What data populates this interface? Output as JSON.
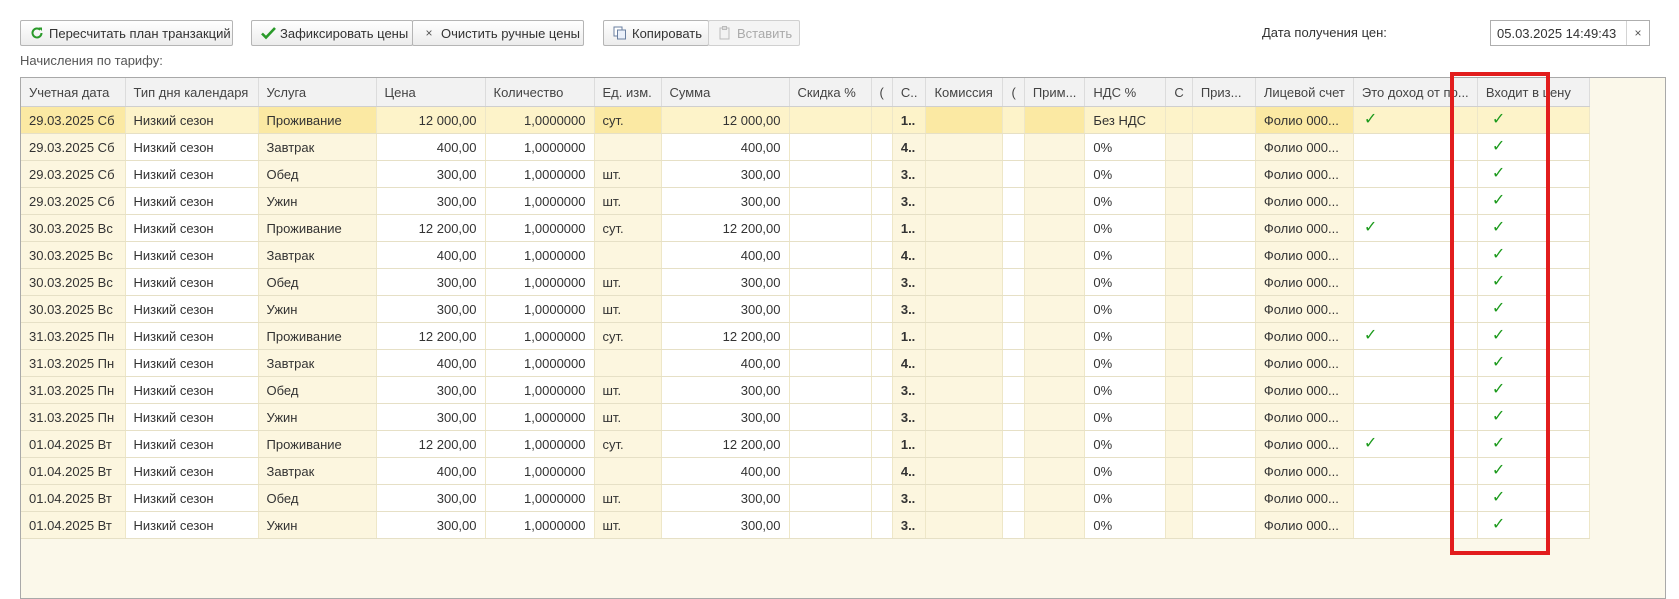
{
  "toolbar": {
    "recalc_label": "Пересчитать план транзакций",
    "fix_prices_label": "Зафиксировать цены",
    "clear_manual_label": "Очистить ручные цены",
    "copy_label": "Копировать",
    "paste_label": "Вставить"
  },
  "price_date": {
    "label": "Дата получения цен:",
    "value": "05.03.2025 14:49:43"
  },
  "section_label": "Начисления по тарифу:",
  "colors": {
    "check": "#1c9a1c",
    "highlight_frame": "#e21d1d",
    "selected_row": "#fdf3c9"
  },
  "columns": [
    "Учетная дата",
    "Тип дня календаря",
    "Услуга",
    "Цена",
    "Количество",
    "Ед. изм.",
    "Сумма",
    "Скидка %",
    "(",
    "С..",
    "Комиссия",
    "(",
    "Прим...",
    "НДС %",
    "С",
    "Приз...",
    "Лицевой счет",
    "Это доход от пр...",
    "Входит в цену"
  ],
  "rows": [
    {
      "date": "29.03.2025 Сб",
      "daytype": "Низкий сезон",
      "service": "Проживание",
      "price": "12 000,00",
      "qty": "1,0000000",
      "unit": "сут.",
      "sum": "12 000,00",
      "c": "1..",
      "vat": "Без НДС",
      "account": "Фолио 000...",
      "income": "✓",
      "incl": "✓"
    },
    {
      "date": "29.03.2025 Сб",
      "daytype": "Низкий сезон",
      "service": "Завтрак",
      "price": "400,00",
      "qty": "1,0000000",
      "unit": "",
      "sum": "400,00",
      "c": "4..",
      "vat": "0%",
      "account": "Фолио 000...",
      "income": "",
      "incl": "✓"
    },
    {
      "date": "29.03.2025 Сб",
      "daytype": "Низкий сезон",
      "service": "Обед",
      "price": "300,00",
      "qty": "1,0000000",
      "unit": "шт.",
      "sum": "300,00",
      "c": "3..",
      "vat": "0%",
      "account": "Фолио 000...",
      "income": "",
      "incl": "✓"
    },
    {
      "date": "29.03.2025 Сб",
      "daytype": "Низкий сезон",
      "service": "Ужин",
      "price": "300,00",
      "qty": "1,0000000",
      "unit": "шт.",
      "sum": "300,00",
      "c": "3..",
      "vat": "0%",
      "account": "Фолио 000...",
      "income": "",
      "incl": "✓"
    },
    {
      "date": "30.03.2025 Вс",
      "daytype": "Низкий сезон",
      "service": "Проживание",
      "price": "12 200,00",
      "qty": "1,0000000",
      "unit": "сут.",
      "sum": "12 200,00",
      "c": "1..",
      "vat": "0%",
      "account": "Фолио 000...",
      "income": "✓",
      "incl": "✓"
    },
    {
      "date": "30.03.2025 Вс",
      "daytype": "Низкий сезон",
      "service": "Завтрак",
      "price": "400,00",
      "qty": "1,0000000",
      "unit": "",
      "sum": "400,00",
      "c": "4..",
      "vat": "0%",
      "account": "Фолио 000...",
      "income": "",
      "incl": "✓"
    },
    {
      "date": "30.03.2025 Вс",
      "daytype": "Низкий сезон",
      "service": "Обед",
      "price": "300,00",
      "qty": "1,0000000",
      "unit": "шт.",
      "sum": "300,00",
      "c": "3..",
      "vat": "0%",
      "account": "Фолио 000...",
      "income": "",
      "incl": "✓"
    },
    {
      "date": "30.03.2025 Вс",
      "daytype": "Низкий сезон",
      "service": "Ужин",
      "price": "300,00",
      "qty": "1,0000000",
      "unit": "шт.",
      "sum": "300,00",
      "c": "3..",
      "vat": "0%",
      "account": "Фолио 000...",
      "income": "",
      "incl": "✓"
    },
    {
      "date": "31.03.2025 Пн",
      "daytype": "Низкий сезон",
      "service": "Проживание",
      "price": "12 200,00",
      "qty": "1,0000000",
      "unit": "сут.",
      "sum": "12 200,00",
      "c": "1..",
      "vat": "0%",
      "account": "Фолио 000...",
      "income": "✓",
      "incl": "✓"
    },
    {
      "date": "31.03.2025 Пн",
      "daytype": "Низкий сезон",
      "service": "Завтрак",
      "price": "400,00",
      "qty": "1,0000000",
      "unit": "",
      "sum": "400,00",
      "c": "4..",
      "vat": "0%",
      "account": "Фолио 000...",
      "income": "",
      "incl": "✓"
    },
    {
      "date": "31.03.2025 Пн",
      "daytype": "Низкий сезон",
      "service": "Обед",
      "price": "300,00",
      "qty": "1,0000000",
      "unit": "шт.",
      "sum": "300,00",
      "c": "3..",
      "vat": "0%",
      "account": "Фолио 000...",
      "income": "",
      "incl": "✓"
    },
    {
      "date": "31.03.2025 Пн",
      "daytype": "Низкий сезон",
      "service": "Ужин",
      "price": "300,00",
      "qty": "1,0000000",
      "unit": "шт.",
      "sum": "300,00",
      "c": "3..",
      "vat": "0%",
      "account": "Фолио 000...",
      "income": "",
      "incl": "✓"
    },
    {
      "date": "01.04.2025 Вт",
      "daytype": "Низкий сезон",
      "service": "Проживание",
      "price": "12 200,00",
      "qty": "1,0000000",
      "unit": "сут.",
      "sum": "12 200,00",
      "c": "1..",
      "vat": "0%",
      "account": "Фолио 000...",
      "income": "✓",
      "incl": "✓"
    },
    {
      "date": "01.04.2025 Вт",
      "daytype": "Низкий сезон",
      "service": "Завтрак",
      "price": "400,00",
      "qty": "1,0000000",
      "unit": "",
      "sum": "400,00",
      "c": "4..",
      "vat": "0%",
      "account": "Фолио 000...",
      "income": "",
      "incl": "✓"
    },
    {
      "date": "01.04.2025 Вт",
      "daytype": "Низкий сезон",
      "service": "Обед",
      "price": "300,00",
      "qty": "1,0000000",
      "unit": "шт.",
      "sum": "300,00",
      "c": "3..",
      "vat": "0%",
      "account": "Фолио 000...",
      "income": "",
      "incl": "✓"
    },
    {
      "date": "01.04.2025 Вт",
      "daytype": "Низкий сезон",
      "service": "Ужин",
      "price": "300,00",
      "qty": "1,0000000",
      "unit": "шт.",
      "sum": "300,00",
      "c": "3..",
      "vat": "0%",
      "account": "Фолио 000...",
      "income": "",
      "incl": "✓"
    }
  ]
}
